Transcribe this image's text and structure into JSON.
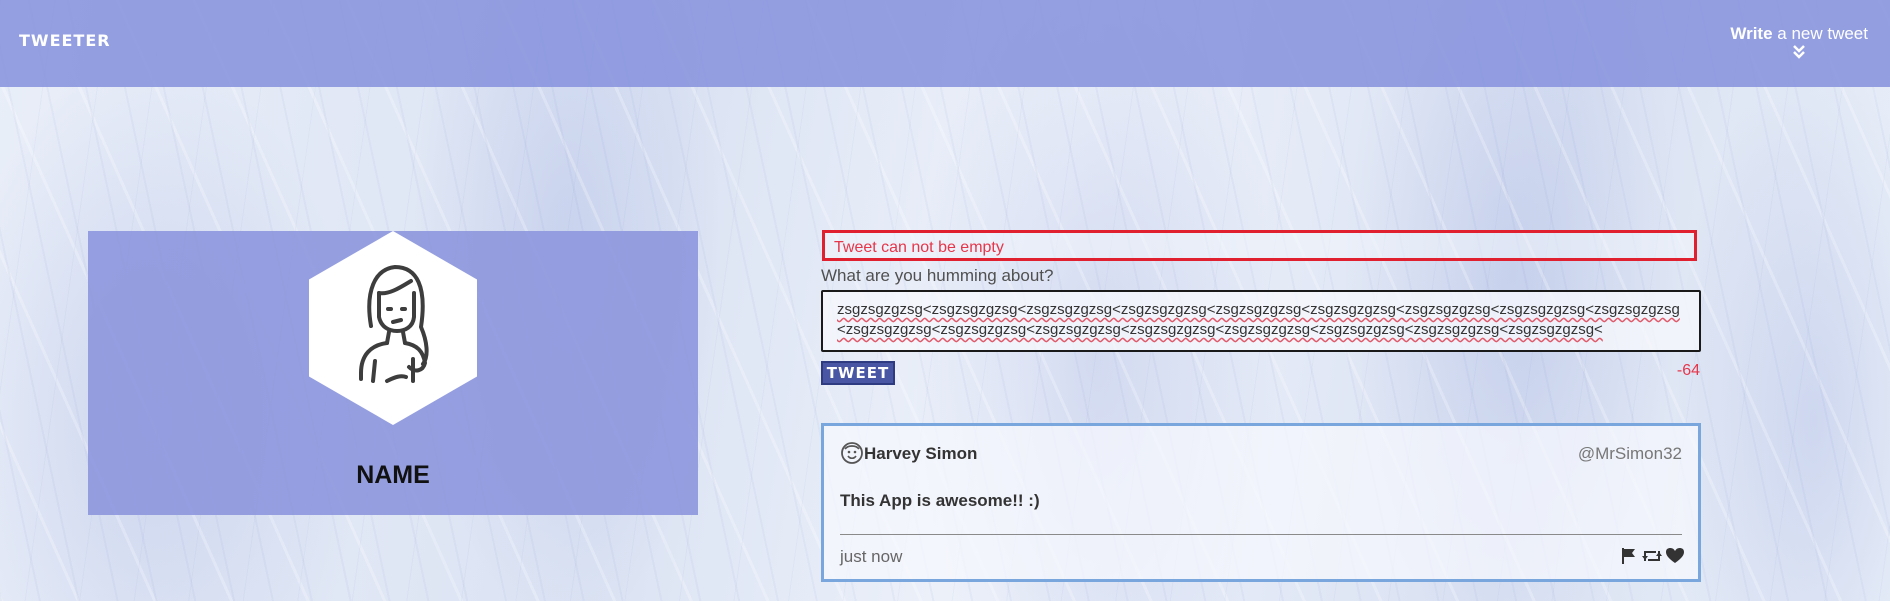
{
  "header": {
    "brand": "TWEETER",
    "write_bold": "Write",
    "write_rest": " a new tweet",
    "background_color": "#8a96de"
  },
  "profile": {
    "name": "NAME",
    "avatar_icon": "woman-avatar-icon",
    "card_color": "#8f99de"
  },
  "compose": {
    "error": "Tweet can not be empty",
    "prompt": "What are you humming about?",
    "text": "zsgzsgzgzsg<zsgzsgzgzsg<zsgzsgzgzsg<zsgzsgzgzsg<zsgzsgzgzsg<zsgzsgzgzsg<zsgzsgzgzsg<zsgzsgzgzsg<zsgzsgzgzsg<zsgzsgzgzsg<zsgzsgzgzsg<zsgzsgzgzsg<zsgzsgzgzsg<zsgzsgzgzsg<zsgzsgzgzsg<zsgzsgzgzsg<zsgzsgzgzsg<",
    "button_label": "TWEET",
    "char_count": "-64",
    "error_color": "#e0202e",
    "button_color": "#4856a4"
  },
  "tweet": {
    "author": "Harvey Simon",
    "handle": "@MrSimon32",
    "text": "This App is awesome!! :)",
    "time": "just now",
    "avatar_icon": "smiling-face-icon",
    "actions": [
      "flag-icon",
      "retweet-icon",
      "heart-icon"
    ],
    "border_color": "#78a6dd"
  }
}
